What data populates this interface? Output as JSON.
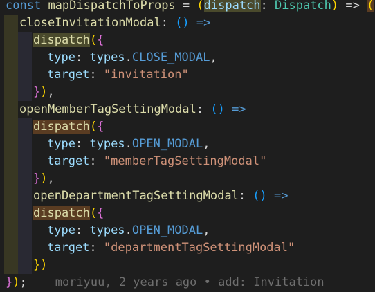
{
  "colors": {
    "background": "#1e1e1e",
    "text": "#d4d4d4",
    "keyword": "#569cd6",
    "function": "#dcdcaa",
    "property": "#9cdcfe",
    "type": "#4ec9b0",
    "string": "#ce9178",
    "bracket_gold": "#ffd700",
    "bracket_magenta": "#da70d6",
    "bracket_blue": "#179fff",
    "blame": "#6e6e6e",
    "indent_guide_1": "#3b3a23",
    "indent_guide_2": "#2a2a35",
    "dispatch_highlight": "#4a4a2c",
    "brace_highlight": "#5a3c22"
  },
  "blame": {
    "text": "moriyuu, 2 years ago • add: Invitation"
  },
  "code_lines": [
    {
      "indent": 0,
      "tokens": [
        {
          "t": "const",
          "c": "keyword"
        },
        {
          "t": " "
        },
        {
          "t": "mapDispatchToProps",
          "c": "function"
        },
        {
          "t": " = "
        },
        {
          "t": "(",
          "c": "bracket_gold"
        },
        {
          "t": "dispatch",
          "c": "property",
          "hl": "dispatch_highlight"
        },
        {
          "t": ": "
        },
        {
          "t": "Dispatch",
          "c": "type"
        },
        {
          "t": ")",
          "c": "bracket_gold"
        },
        {
          "t": " => "
        },
        {
          "t": "(",
          "c": "bracket_gold",
          "hl": "brace_highlight"
        },
        {
          "t": "{",
          "c": "bracket_magenta"
        }
      ]
    },
    {
      "indent": 1,
      "tokens": [
        {
          "t": "closeInvitationModal",
          "c": "function"
        },
        {
          "t": ": "
        },
        {
          "t": "()",
          "c": "bracket_blue"
        },
        {
          "t": " => ",
          "c": "keyword"
        }
      ]
    },
    {
      "indent": 2,
      "tokens": [
        {
          "t": "dispatch",
          "c": "function",
          "hl": "dispatch_highlight"
        },
        {
          "t": "(",
          "c": "bracket_gold"
        },
        {
          "t": "{",
          "c": "bracket_magenta"
        }
      ]
    },
    {
      "indent": 3,
      "tokens": [
        {
          "t": "type",
          "c": "property"
        },
        {
          "t": ": "
        },
        {
          "t": "types",
          "c": "property"
        },
        {
          "t": "."
        },
        {
          "t": "CLOSE_MODAL",
          "c": "keyword"
        },
        {
          "t": ","
        }
      ]
    },
    {
      "indent": 3,
      "tokens": [
        {
          "t": "target",
          "c": "property"
        },
        {
          "t": ": "
        },
        {
          "t": "\"invitation\"",
          "c": "string"
        }
      ]
    },
    {
      "indent": 2,
      "tokens": [
        {
          "t": "}",
          "c": "bracket_magenta"
        },
        {
          "t": ")",
          "c": "bracket_gold"
        },
        {
          "t": ","
        }
      ]
    },
    {
      "indent": 1,
      "tokens": [
        {
          "t": "openMemberTagSettingModal",
          "c": "function"
        },
        {
          "t": ": "
        },
        {
          "t": "()",
          "c": "bracket_blue"
        },
        {
          "t": " => ",
          "c": "keyword"
        }
      ]
    },
    {
      "indent": 2,
      "tokens": [
        {
          "t": "dispatch",
          "c": "function",
          "hl": "brace_highlight"
        },
        {
          "t": "(",
          "c": "bracket_gold"
        },
        {
          "t": "{",
          "c": "bracket_magenta"
        }
      ]
    },
    {
      "indent": 3,
      "tokens": [
        {
          "t": "type",
          "c": "property"
        },
        {
          "t": ": "
        },
        {
          "t": "types",
          "c": "property"
        },
        {
          "t": "."
        },
        {
          "t": "OPEN_MODAL",
          "c": "keyword"
        },
        {
          "t": ","
        }
      ]
    },
    {
      "indent": 3,
      "tokens": [
        {
          "t": "target",
          "c": "property"
        },
        {
          "t": ": "
        },
        {
          "t": "\"memberTagSettingModal\"",
          "c": "string"
        }
      ]
    },
    {
      "indent": 2,
      "tokens": [
        {
          "t": "}",
          "c": "bracket_magenta"
        },
        {
          "t": ")",
          "c": "bracket_gold"
        },
        {
          "t": ","
        }
      ]
    },
    {
      "indent": 2,
      "tokens": [
        {
          "t": "openDepartmentTagSettingModal",
          "c": "function"
        },
        {
          "t": ": "
        },
        {
          "t": "()",
          "c": "bracket_blue"
        },
        {
          "t": " => ",
          "c": "keyword"
        }
      ]
    },
    {
      "indent": 2,
      "tokens": [
        {
          "t": "dispatch",
          "c": "function",
          "hl": "brace_highlight"
        },
        {
          "t": "(",
          "c": "bracket_gold"
        },
        {
          "t": "{",
          "c": "bracket_magenta"
        }
      ]
    },
    {
      "indent": 3,
      "tokens": [
        {
          "t": "type",
          "c": "property"
        },
        {
          "t": ": "
        },
        {
          "t": "types",
          "c": "property"
        },
        {
          "t": "."
        },
        {
          "t": "OPEN_MODAL",
          "c": "keyword"
        },
        {
          "t": ","
        }
      ]
    },
    {
      "indent": 3,
      "tokens": [
        {
          "t": "target",
          "c": "property"
        },
        {
          "t": ": "
        },
        {
          "t": "\"departmentTagSettingModal\"",
          "c": "string"
        }
      ]
    },
    {
      "indent": 2,
      "tokens": [
        {
          "t": "})",
          "c": "bracket_gold"
        }
      ]
    },
    {
      "indent": 0,
      "tokens": [
        {
          "t": "}",
          "c": "bracket_magenta"
        },
        {
          "t": ")",
          "c": "bracket_gold"
        },
        {
          "t": ";"
        },
        {
          "t": "    "
        },
        {
          "blame": true
        }
      ]
    }
  ]
}
